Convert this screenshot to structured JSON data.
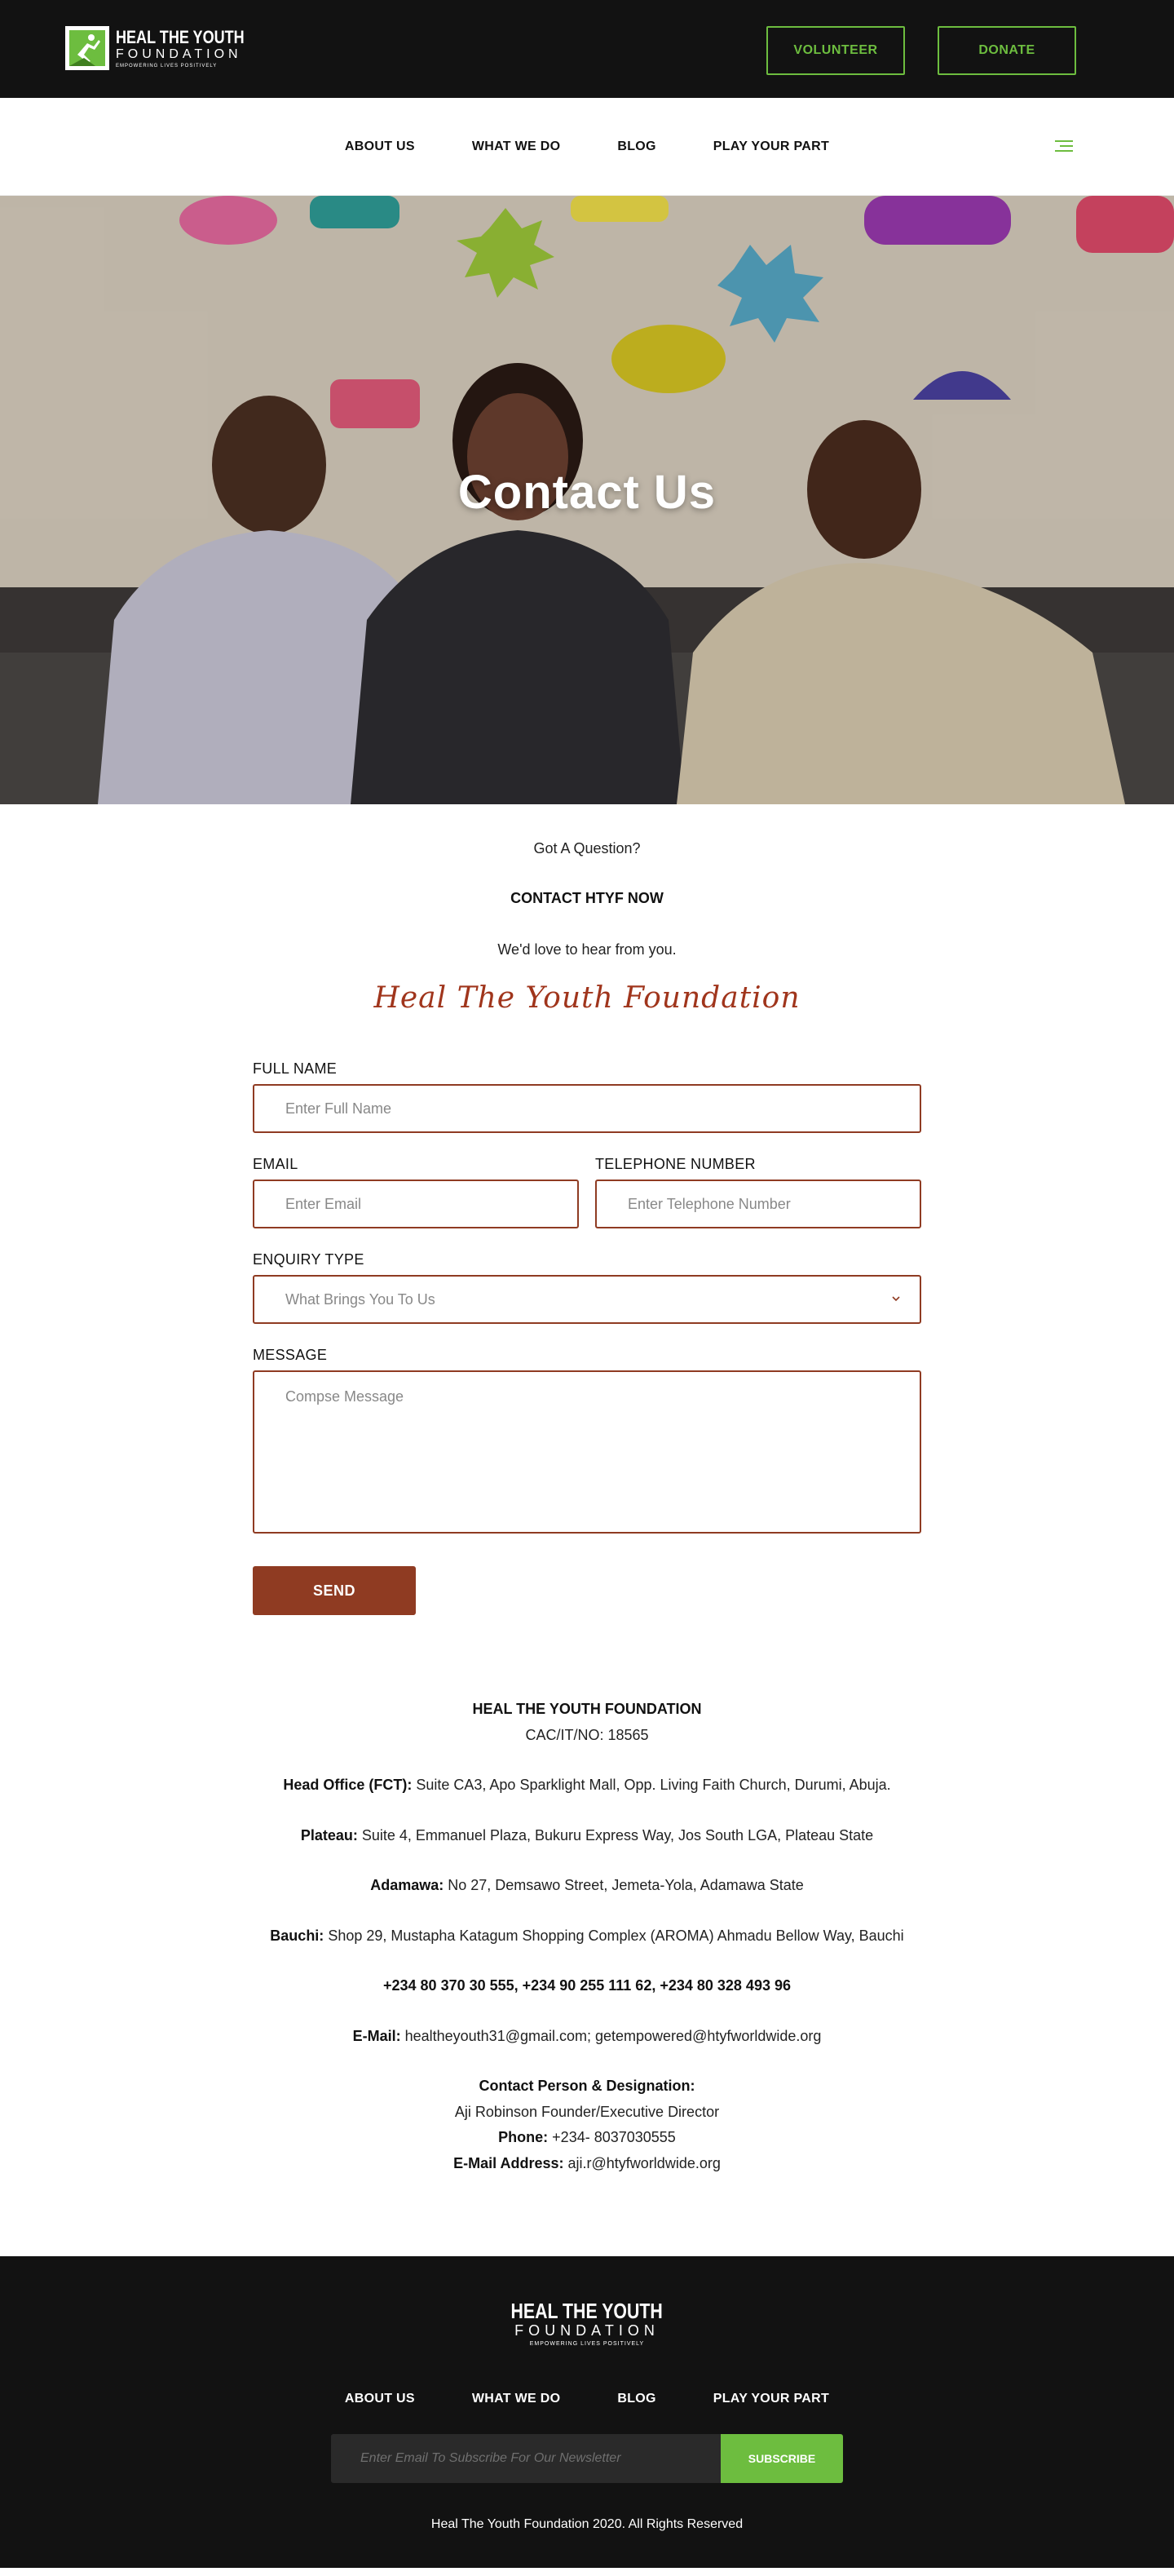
{
  "header": {
    "logo": {
      "line1": "HEAL THE YOUTH",
      "line2": "FOUNDATION",
      "tagline": "EMPOWERING LIVES POSITIVELY"
    },
    "volunteer_label": "VOLUNTEER",
    "donate_label": "DONATE",
    "accent_color": "#6dbd3f"
  },
  "nav": {
    "items": [
      {
        "label": "ABOUT US"
      },
      {
        "label": "WHAT WE DO"
      },
      {
        "label": "BLOG"
      },
      {
        "label": "PLAY YOUR PART"
      }
    ],
    "menu_icon": "hamburger-icon"
  },
  "hero": {
    "title": "Contact Us"
  },
  "intro": {
    "question": "Got A Question?",
    "cta": "CONTACT HTYF NOW",
    "subtitle": "We'd love to hear from you.",
    "signature": "Heal The Youth Foundation"
  },
  "form": {
    "full_name": {
      "label": "FULL NAME",
      "placeholder": "Enter Full Name"
    },
    "email": {
      "label": "EMAIL",
      "placeholder": "Enter Email"
    },
    "telephone": {
      "label": "TELEPHONE NUMBER",
      "placeholder": "Enter Telephone Number"
    },
    "enquiry": {
      "label": "ENQUIRY TYPE",
      "selected": "What Brings You To Us"
    },
    "message": {
      "label": "MESSAGE",
      "placeholder": "Compse Message"
    },
    "send_label": "SEND",
    "accent_color": "#8f3b22"
  },
  "info": {
    "org_name": "HEAL THE YOUTH FOUNDATION",
    "cac": "CAC/IT/NO: 18565",
    "offices": [
      {
        "label": "Head Office (FCT):",
        "address": " Suite CA3, Apo Sparklight Mall, Opp. Living Faith Church, Durumi, Abuja."
      },
      {
        "label": "Plateau:",
        "address": " Suite 4, Emmanuel Plaza, Bukuru Express Way, Jos South LGA, Plateau State"
      },
      {
        "label": "Adamawa:",
        "address": " No 27, Demsawo Street, Jemeta-Yola, Adamawa State"
      },
      {
        "label": "Bauchi:",
        "address": " Shop 29, Mustapha Katagum Shopping Complex (AROMA) Ahmadu Bellow Way, Bauchi"
      }
    ],
    "phones": "+234 80 370 30 555, +234 90 255 111 62, +234 80 328 493 96",
    "email_label": "E-Mail:",
    "emails": " healtheyouth31@gmail.com; getempowered@htyfworldwide.org",
    "contact_heading": "Contact Person & Designation:",
    "contact_person": "Aji Robinson Founder/Executive Director",
    "phone_label": "Phone:",
    "phone_value": " +234- 8037030555",
    "email_address_label": "E-Mail Address:",
    "email_address_value": " aji.r@htyfworldwide.org"
  },
  "footer": {
    "logo": {
      "line1": "HEAL THE YOUTH",
      "line2": "FOUNDATION",
      "tagline": "EMPOWERING LIVES POSITIVELY"
    },
    "nav": [
      {
        "label": "ABOUT US"
      },
      {
        "label": "WHAT WE DO"
      },
      {
        "label": "BLOG"
      },
      {
        "label": "PLAY YOUR PART"
      }
    ],
    "newsletter_placeholder": "Enter Email To Subscribe For Our Newsletter",
    "subscribe_label": "SUBSCRIBE",
    "copyright": "Heal The Youth Foundation 2020. All Rights Reserved"
  }
}
